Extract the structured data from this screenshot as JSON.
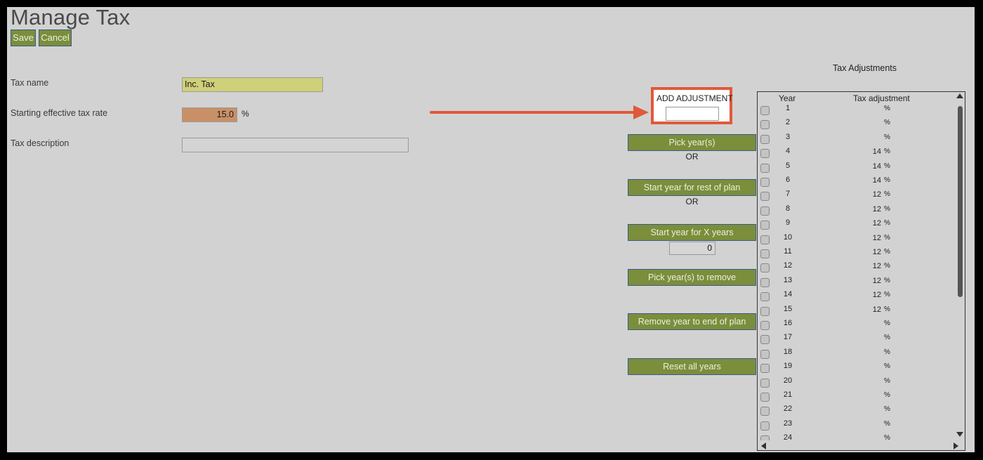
{
  "page": {
    "title": "Manage Tax"
  },
  "toolbar": {
    "save_label": "Save",
    "cancel_label": "Cancel"
  },
  "form": {
    "tax_name_label": "Tax name",
    "tax_name_value": "Inc. Tax",
    "rate_label": "Starting effective tax rate",
    "rate_value": "15.0",
    "rate_unit": "%",
    "description_label": "Tax description",
    "description_value": ""
  },
  "adjustment": {
    "add_label": "ADD ADJUSTMENT",
    "add_value": "",
    "pick_years_label": "Pick year(s)",
    "or1": "OR",
    "rest_of_plan_label": "Start year for rest of plan",
    "or2": "OR",
    "x_years_label": "Start year for X years",
    "x_years_value": "0",
    "remove_label": "Pick year(s) to remove",
    "remove_end_label": "Remove year to end of plan",
    "reset_label": "Reset all years"
  },
  "panel": {
    "title": "Tax Adjustments",
    "col_year": "Year",
    "col_adjustment": "Tax adjustment",
    "rows": [
      {
        "year": "1",
        "value": "",
        "unit": "%"
      },
      {
        "year": "2",
        "value": "",
        "unit": "%"
      },
      {
        "year": "3",
        "value": "",
        "unit": "%"
      },
      {
        "year": "4",
        "value": "14",
        "unit": "%"
      },
      {
        "year": "5",
        "value": "14",
        "unit": "%"
      },
      {
        "year": "6",
        "value": "14",
        "unit": "%"
      },
      {
        "year": "7",
        "value": "12",
        "unit": "%"
      },
      {
        "year": "8",
        "value": "12",
        "unit": "%"
      },
      {
        "year": "9",
        "value": "12",
        "unit": "%"
      },
      {
        "year": "10",
        "value": "12",
        "unit": "%"
      },
      {
        "year": "11",
        "value": "12",
        "unit": "%"
      },
      {
        "year": "12",
        "value": "12",
        "unit": "%"
      },
      {
        "year": "13",
        "value": "12",
        "unit": "%"
      },
      {
        "year": "14",
        "value": "12",
        "unit": "%"
      },
      {
        "year": "15",
        "value": "12",
        "unit": "%"
      },
      {
        "year": "16",
        "value": "",
        "unit": "%"
      },
      {
        "year": "17",
        "value": "",
        "unit": "%"
      },
      {
        "year": "18",
        "value": "",
        "unit": "%"
      },
      {
        "year": "19",
        "value": "",
        "unit": "%"
      },
      {
        "year": "20",
        "value": "",
        "unit": "%"
      },
      {
        "year": "21",
        "value": "",
        "unit": "%"
      },
      {
        "year": "22",
        "value": "",
        "unit": "%"
      },
      {
        "year": "23",
        "value": "",
        "unit": "%"
      },
      {
        "year": "24",
        "value": "",
        "unit": "%"
      }
    ]
  },
  "colors": {
    "button_green": "#7a8e3c",
    "tax_name_bg": "#cfd07a",
    "rate_bg": "#c99068",
    "highlight_orange": "#e0593a"
  },
  "icons": {
    "arrow": "arrow-right-icon",
    "scroll_up": "chevron-up-icon",
    "scroll_down": "chevron-down-icon",
    "scroll_left": "chevron-left-icon",
    "scroll_right": "chevron-right-icon"
  }
}
